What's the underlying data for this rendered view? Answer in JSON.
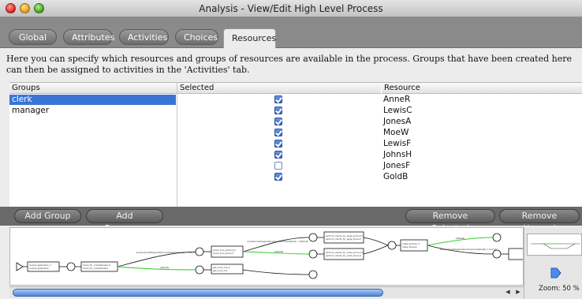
{
  "window": {
    "title": "Analysis - View/Edit High Level Process"
  },
  "tabs": [
    {
      "label": "Global",
      "active": false
    },
    {
      "label": "Attributes",
      "active": false
    },
    {
      "label": "Activities",
      "active": false
    },
    {
      "label": "Choices",
      "active": false
    },
    {
      "label": "Resources",
      "active": true
    }
  ],
  "description": "Here you can specify which resources and groups of resources are available in the process. Groups that have been created here can then be assigned to activities in the 'Activities' tab.",
  "table": {
    "headers": {
      "groups": "Groups",
      "selected": "Selected",
      "resource": "Resource"
    },
    "groups": [
      {
        "name": "clerk",
        "selected": true
      },
      {
        "name": "manager",
        "selected": false
      }
    ],
    "resources": [
      {
        "name": "AnneR",
        "checked": true
      },
      {
        "name": "LewisC",
        "checked": true
      },
      {
        "name": "JonesA",
        "checked": true
      },
      {
        "name": "MoeW",
        "checked": true
      },
      {
        "name": "LewisF",
        "checked": true
      },
      {
        "name": "JohnsH",
        "checked": true
      },
      {
        "name": "JonesF",
        "checked": false
      },
      {
        "name": "GoldB",
        "checked": true
      }
    ]
  },
  "buttons": {
    "add_group": "Add Group",
    "add_resource": "Add Resource",
    "remove_selected": "Remove Selected",
    "remove_unused": "Remove Unused"
  },
  "diagram": {
    "zoom_label": "Zoom: 50 %",
    "edge_color_highlight": "#33cc33"
  },
  "colors": {
    "selection": "#3875d7",
    "tabbar": "#8a8a8a",
    "buttonbar": "#6a6a6a"
  }
}
